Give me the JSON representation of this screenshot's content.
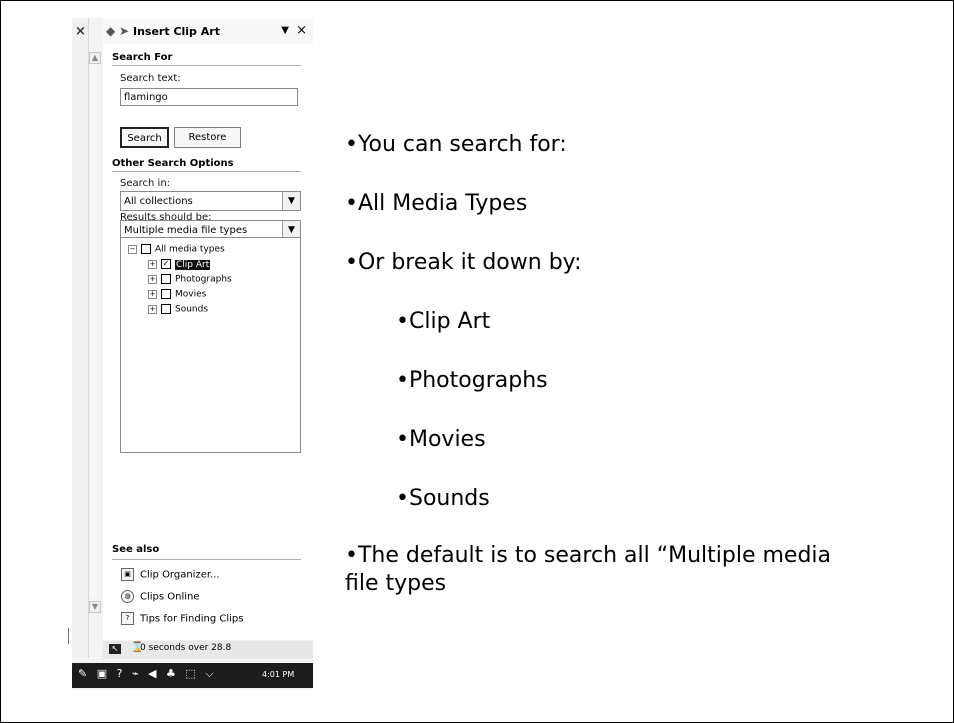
{
  "task_pane": {
    "title": "Insert Clip Art",
    "search_for_heading": "Search For",
    "search_text_label": "Search text:",
    "search_text_value": "flamingo",
    "search_button": "Search",
    "restore_button": "Restore",
    "other_options_heading": "Other Search Options",
    "search_in_label": "Search in:",
    "search_in_value": "All collections",
    "results_label": "Results should be:",
    "results_value": "Multiple media file types",
    "media_tree": [
      {
        "label": "All media types",
        "checked": false
      },
      {
        "label": "Clip Art",
        "checked": true
      },
      {
        "label": "Photographs",
        "checked": false
      },
      {
        "label": "Movies",
        "checked": false
      },
      {
        "label": "Sounds",
        "checked": false
      }
    ],
    "see_also_heading": "See also",
    "links": [
      "Clip Organizer...",
      "Clips Online",
      "Tips for Finding Clips"
    ]
  },
  "status": {
    "text": "0 seconds over 28.8"
  },
  "taskbar": {
    "time": "4:01 PM"
  },
  "slide_text": {
    "line1": "•You can search for:",
    "line2": "•All Media Types",
    "line3": "•Or break it down by:",
    "sub1": "•Clip Art",
    "sub2": "•Photographs",
    "sub3": "•Movies",
    "sub4": "•Sounds",
    "line4": "•The default is to search all “Multiple media file types"
  }
}
